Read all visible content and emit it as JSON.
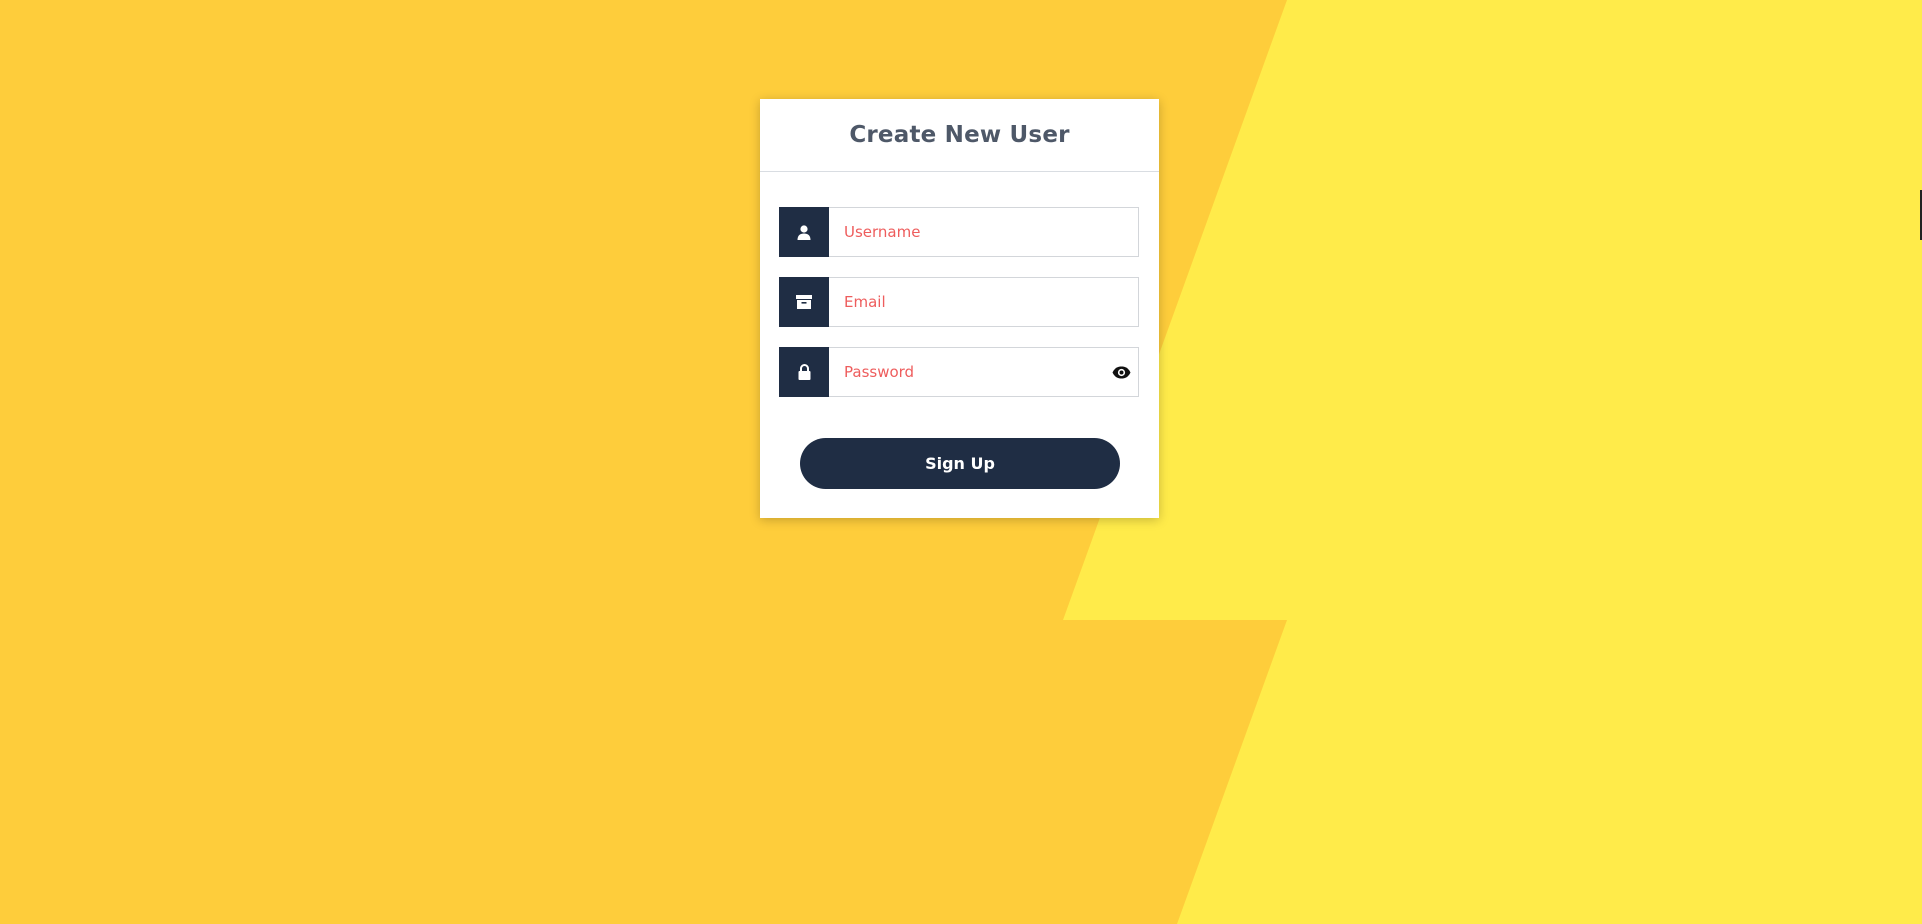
{
  "colors": {
    "bg_left": "#fecd3b",
    "bg_right": "#ffeb4a",
    "card": "#ffffff",
    "accent_dark": "#1f2d44",
    "title": "#4e5868",
    "placeholder": "#ee5d5d"
  },
  "form": {
    "title": "Create New User",
    "fields": [
      {
        "icon": "user-icon",
        "placeholder": "Username",
        "type": "text",
        "value": ""
      },
      {
        "icon": "archive-icon",
        "placeholder": "Email",
        "type": "email",
        "value": ""
      },
      {
        "icon": "lock-icon",
        "placeholder": "Password",
        "type": "password",
        "value": "",
        "toggle_icon": "eye-icon"
      }
    ],
    "submit_label": "Sign Up"
  }
}
